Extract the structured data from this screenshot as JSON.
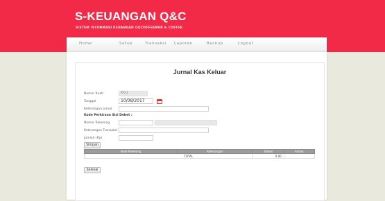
{
  "header": {
    "title": "S-KEUANGAN Q&C",
    "subtitle": "SISTEM INFORMASI KEUANGAN QQCOFFEEMER & COFFEE"
  },
  "nav": {
    "items": [
      "Home",
      "Setup",
      "Transaksi",
      "Laporan",
      "Backup",
      "Logout"
    ]
  },
  "form": {
    "title": "Jurnal Kas Keluar",
    "nomor_bukti_label": "Nomor Bukti",
    "nomor_bukti_value": "KK/2",
    "tanggal_label": "Tanggal",
    "tanggal_value": "10/08/2017",
    "keterangan_jurnal_label": "Keterangan Jurnal",
    "keterangan_jurnal_value": "",
    "kode_perkiraan_heading": "Kode Perkiraan Sisi Debet :",
    "nomor_rekening_label": "Nomor Rekening",
    "nomor_rekening_value": "",
    "keterangan_transaksi_label": "Keterangan Transaksi",
    "keterangan_transaksi_value": "",
    "jumlah_label": "Jumlah (Rp)",
    "jumlah_value": "",
    "simpan_label": "Simpan",
    "selesai_label": "Selesai"
  },
  "table": {
    "headers": [
      "Kode Rekening",
      "Keterangan",
      "Debet",
      "Action"
    ],
    "total_label": "TOTAL",
    "total_value": "0.00"
  },
  "colors": {
    "header_bg": "#f22a48",
    "page_bg": "#eae9dd",
    "table_header_bg": "#9c9c9c"
  }
}
